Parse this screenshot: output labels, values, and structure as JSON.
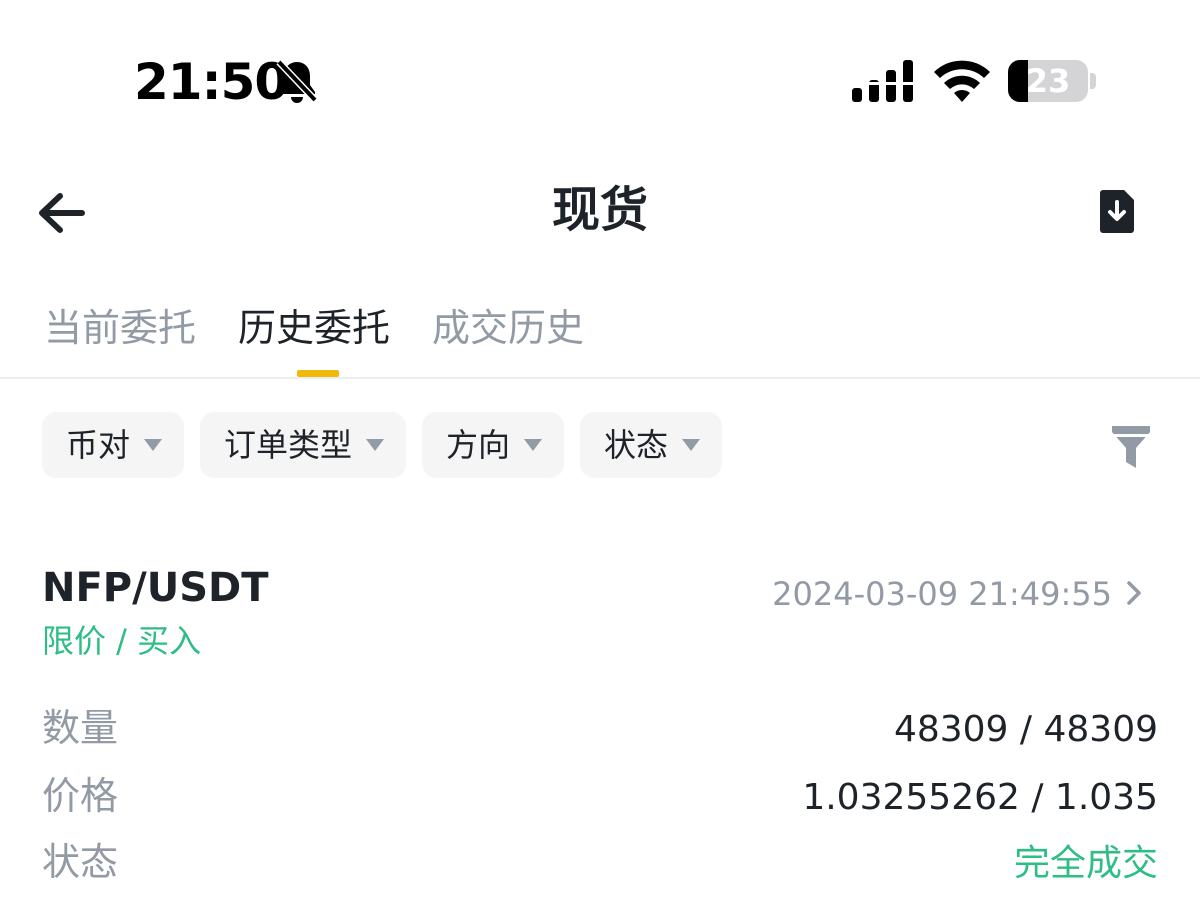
{
  "status_bar": {
    "time": "21:50",
    "battery_level": "23",
    "icons": [
      "bell-slash-icon",
      "signal-icon",
      "wifi-icon",
      "battery-icon"
    ]
  },
  "nav": {
    "title": "现货",
    "back_icon": "arrow-left-icon",
    "export_icon": "file-download-icon"
  },
  "tabs": [
    {
      "label": "当前委托",
      "active": false
    },
    {
      "label": "历史委托",
      "active": true
    },
    {
      "label": "成交历史",
      "active": false
    }
  ],
  "filters": [
    {
      "label": "币对"
    },
    {
      "label": "订单类型"
    },
    {
      "label": "方向"
    },
    {
      "label": "状态"
    }
  ],
  "order": {
    "pair": "NFP/USDT",
    "time": "2024-03-09 21:49:55",
    "type": "限价 / 买入",
    "rows": [
      {
        "label": "数量",
        "value": "48309 / 48309"
      },
      {
        "label": "价格",
        "value": "1.03255262 / 1.035"
      },
      {
        "label": "状态",
        "value": "完全成交"
      }
    ]
  },
  "colors": {
    "accent": "#f0b90b",
    "buy_green": "#2ebd85",
    "text_primary": "#1e2329",
    "text_secondary": "#929aa5",
    "chip_bg": "#f5f5f5"
  }
}
